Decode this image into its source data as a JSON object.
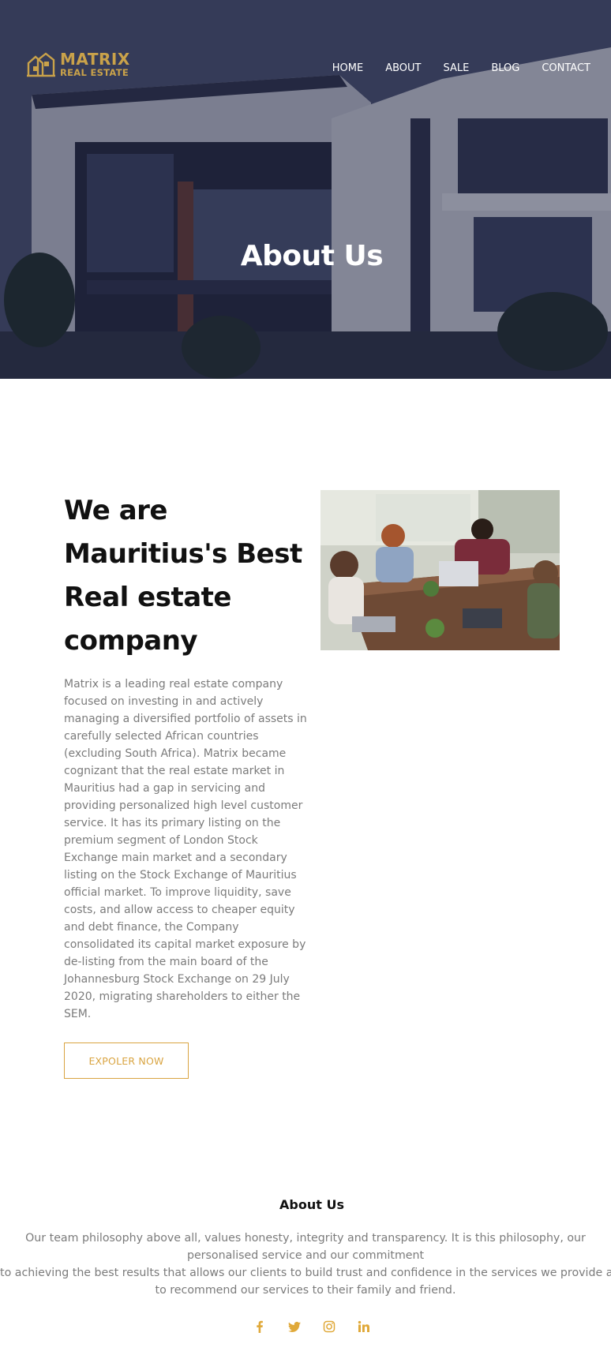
{
  "brand": {
    "line1": "MATRIX",
    "line2": "REAL ESTATE",
    "color": "#c9a24a"
  },
  "nav": {
    "items": [
      {
        "label": "HOME"
      },
      {
        "label": "ABOUT"
      },
      {
        "label": "SALE"
      },
      {
        "label": "BLOG"
      },
      {
        "label": "CONTACT"
      }
    ]
  },
  "hero": {
    "title": "About Us"
  },
  "intro": {
    "heading": "We are Mauritius's Best Real estate company",
    "body": "Matrix is a leading real estate company focused on investing in and actively managing a diversified portfolio of assets in carefully selected African countries (excluding South Africa). Matrix became cognizant that the real estate market in Mauritius had a gap in servicing and providing personalized high level customer service. It has its primary listing on the premium segment of London Stock Exchange main market and a secondary listing on the Stock Exchange of Mauritius official market. To improve liquidity, save costs, and allow access to cheaper equity and debt finance, the Company consolidated its capital market exposure by de-listing from the main board of the Johannesburg Stock Exchange on 29 July 2020, migrating shareholders to either the SEM.",
    "button_label": "EXPOLER NOW",
    "accent": "#d9a441"
  },
  "footer": {
    "title": "About Us",
    "lines": [
      "Our team philosophy above all, values honesty, integrity and transparency. It is this philosophy, our",
      "personalised service and our commitment",
      "to achieving the best results that allows our clients to build trust and confidence in the services we provide and",
      "to recommend our services to their family and friend."
    ],
    "social": [
      {
        "icon": "facebook-icon"
      },
      {
        "icon": "twitter-icon"
      },
      {
        "icon": "instagram-icon"
      },
      {
        "icon": "linkedin-icon"
      }
    ],
    "social_color": "#e0a93a"
  }
}
